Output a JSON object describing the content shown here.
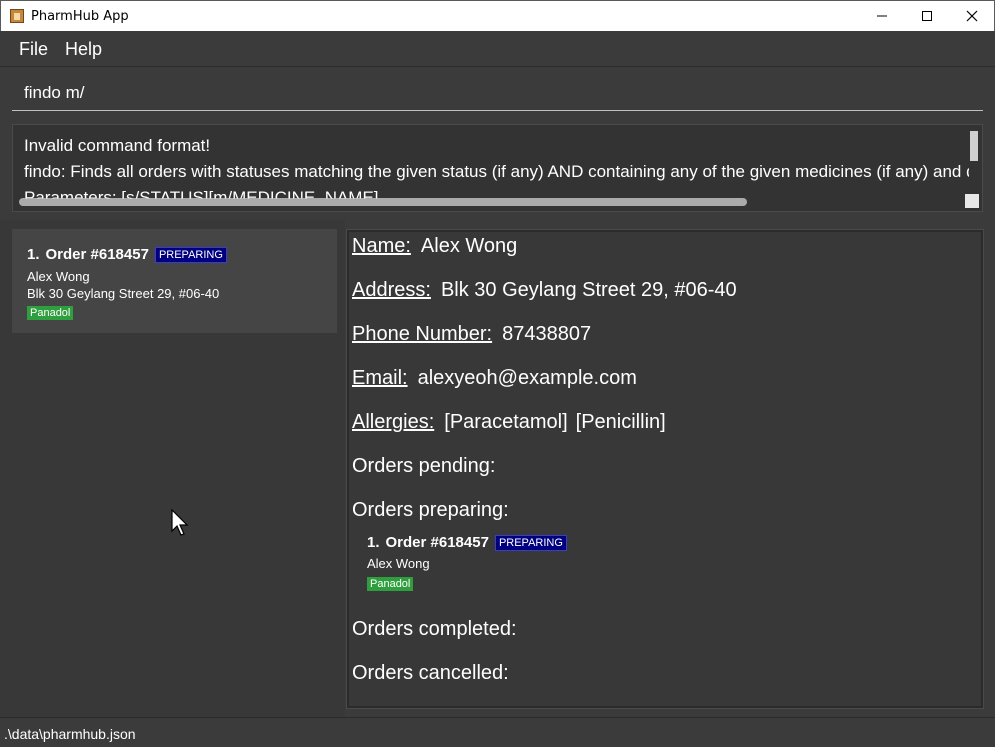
{
  "window": {
    "title": "PharmHub App",
    "icons": {
      "app": "pharmhub-app-icon",
      "minimize": "minimize-icon",
      "maximize": "maximize-icon",
      "close": "close-icon"
    }
  },
  "menu": {
    "file": "File",
    "help": "Help"
  },
  "command": {
    "value": "findo m/"
  },
  "result": {
    "lines": [
      "Invalid command format!",
      "findo: Finds all orders with statuses matching the given status (if any) AND containing any of the given medicines (if any) and displays them as a list with index numbers.",
      "Parameters: [s/STATUS][m/MEDICINE_NAME]..."
    ]
  },
  "order_list": [
    {
      "index": "1.",
      "order_id": "Order #618457",
      "status": "PREPARING",
      "name": "Alex Wong",
      "address": "Blk 30 Geylang Street 29, #06-40",
      "medicine": "Panadol"
    }
  ],
  "person": {
    "name_label": "Name:",
    "name": "Alex Wong",
    "address_label": "Address:",
    "address": "Blk 30 Geylang Street 29, #06-40",
    "phone_label": "Phone Number:",
    "phone": "87438807",
    "email_label": "Email:",
    "email": "alexyeoh@example.com",
    "allergies_label": "Allergies:",
    "allergies": [
      "[Paracetamol]",
      "[Penicillin]"
    ],
    "pending_label": "Orders pending:",
    "preparing_label": "Orders preparing:",
    "preparing_orders": [
      {
        "index": "1.",
        "order_id": "Order #618457",
        "status": "PREPARING",
        "name": "Alex Wong",
        "medicine": "Panadol"
      }
    ],
    "completed_label": "Orders completed:",
    "cancelled_label": "Orders cancelled:"
  },
  "status_bar": {
    "file_path": ".\\data\\pharmhub.json"
  },
  "colors": {
    "status_badge": "#000080",
    "medicine_tag": "#2e9e3e",
    "background": "#3b3b3b"
  }
}
